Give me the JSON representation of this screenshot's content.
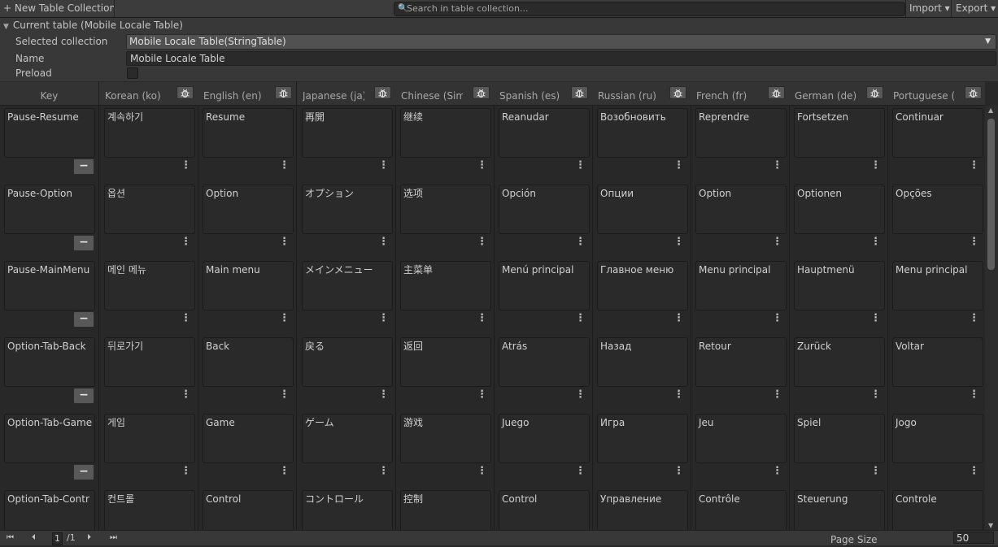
{
  "toolbar": {
    "new_collection": "+ New Table Collection",
    "search_icon": "🔍",
    "search_placeholder": "Search in table collection...",
    "import_label": "Import ▾",
    "export_label": "Export ▾"
  },
  "properties": {
    "foldout_label": "Current table (Mobile Locale Table)",
    "foldout_icon": "triangle-down-icon",
    "selected_collection_label": "Selected collection",
    "selected_collection_value": "Mobile Locale Table(StringTable)",
    "name_label": "Name",
    "name_value": "Mobile Locale Table",
    "preload_label": "Preload",
    "preload_checked": false
  },
  "table": {
    "key_header": "Key",
    "remove_icon": "−",
    "more_icon": "⋮",
    "debug_icon": "bug-icon",
    "columns": [
      {
        "header": "Korean (ko)"
      },
      {
        "header": "English (en)"
      },
      {
        "header": "Japanese (ja)"
      },
      {
        "header": "Chinese (Simp"
      },
      {
        "header": "Spanish (es)"
      },
      {
        "header": "Russian (ru)"
      },
      {
        "header": "French (fr)"
      },
      {
        "header": "German (de)"
      },
      {
        "header": "Portuguese (I"
      }
    ],
    "rows": [
      {
        "key": "Pause-Resume",
        "values": [
          "계속하기",
          "Resume",
          "再開",
          "继续",
          "Reanudar",
          "Возобновить",
          "Reprendre",
          "Fortsetzen",
          "Continuar"
        ]
      },
      {
        "key": "Pause-Option",
        "values": [
          "옵션",
          "Option",
          "オプション",
          "选项",
          "Opción",
          "Опции",
          "Option",
          "Optionen",
          "Opções"
        ]
      },
      {
        "key": "Pause-MainMenu",
        "values": [
          "메인 메뉴",
          "Main menu",
          "メインメニュー",
          "主菜单",
          "Menú principal",
          "Главное меню",
          "Menu principal",
          "Hauptmenü",
          "Menu principal"
        ]
      },
      {
        "key": "Option-Tab-Back",
        "values": [
          "뒤로가기",
          "Back",
          "戻る",
          "返回",
          "Atrás",
          "Назад",
          "Retour",
          "Zurück",
          "Voltar"
        ]
      },
      {
        "key": "Option-Tab-Game",
        "values": [
          "게임",
          "Game",
          "ゲーム",
          "游戏",
          "Juego",
          "Игра",
          "Jeu",
          "Spiel",
          "Jogo"
        ]
      },
      {
        "key": "Option-Tab-Contr",
        "values": [
          "컨트롤",
          "Control",
          "コントロール",
          "控制",
          "Control",
          "Управление",
          "Contrôle",
          "Steuerung",
          "Controle"
        ]
      }
    ]
  },
  "pagination": {
    "first_icon": "⏮",
    "prev_icon": "⏴",
    "current_page": "1",
    "total_pages": "/1",
    "next_icon": "⏵",
    "last_icon": "⏭",
    "page_size_label": "Page Size",
    "page_size_value": "50"
  }
}
